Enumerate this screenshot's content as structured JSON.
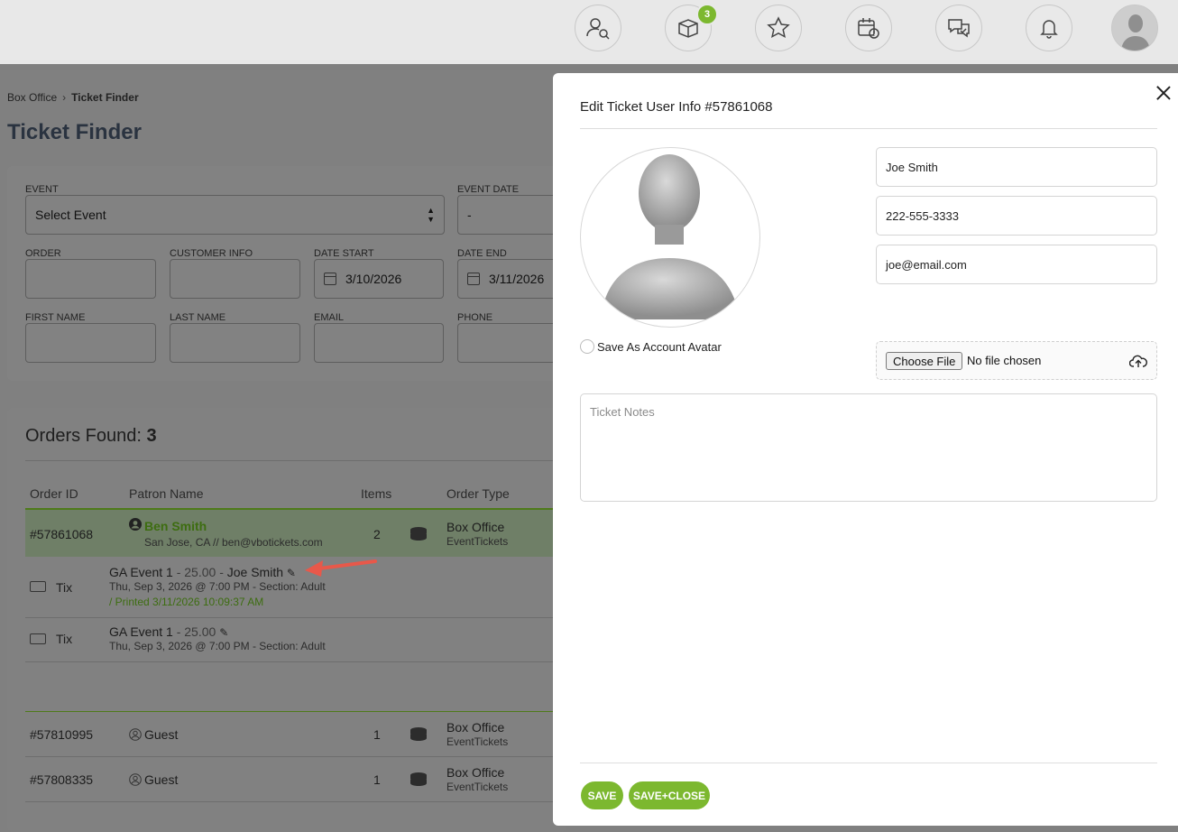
{
  "topbar": {
    "icons": [
      "user-search-icon",
      "box-icon",
      "star-icon",
      "calendar-alert-icon",
      "chat-icon",
      "bell-icon"
    ],
    "box_badge": "3"
  },
  "breadcrumb": {
    "root": "Box Office",
    "current": "Ticket Finder"
  },
  "page_title": "Ticket Finder",
  "filters": {
    "event_label": "EVENT",
    "event_value": "Select Event",
    "event_date_label": "EVENT DATE",
    "event_date_value": "-",
    "order_label": "ORDER",
    "customer_label": "CUSTOMER INFO",
    "date_start_label": "DATE START",
    "date_start_value": "3/10/2026",
    "date_end_label": "DATE END",
    "date_end_value": "3/11/2026",
    "first_name_label": "FIRST NAME",
    "last_name_label": "LAST NAME",
    "email_label": "EMAIL",
    "phone_label": "PHONE"
  },
  "orders": {
    "title": "Orders Found:",
    "count": "3",
    "headers": {
      "order_id": "Order ID",
      "patron": "Patron Name",
      "items": "Items",
      "type": "Order Type"
    },
    "first": {
      "id": "#57861068",
      "name": "Ben Smith",
      "detail": "San Jose, CA // ben@vbotickets.com",
      "items": "2",
      "type": "Box Office",
      "subtype": "EventTickets"
    },
    "tickets": [
      {
        "kind": "Tix",
        "event": "GA Event 1",
        "price": "- 25.00 -",
        "holder": "Joe Smith",
        "when": "Thu, Sep 3, 2026 @ 7:00 PM - Section: Adult",
        "printed": "/ Printed 3/11/2026 10:09:37 AM"
      },
      {
        "kind": "Tix",
        "event": "GA Event 1",
        "price": "- 25.00",
        "when": "Thu, Sep 3, 2026 @ 7:00 PM - Section: Adult"
      }
    ],
    "rows": [
      {
        "id": "#57810995",
        "name": "Guest",
        "items": "1",
        "type": "Box Office",
        "subtype": "EventTickets"
      },
      {
        "id": "#57808335",
        "name": "Guest",
        "items": "1",
        "type": "Box Office",
        "subtype": "EventTickets"
      }
    ]
  },
  "modal": {
    "title": "Edit Ticket User Info #57861068",
    "name_value": "Joe Smith",
    "phone_value": "222-555-3333",
    "email_value": "joe@email.com",
    "save_avatar_label": "Save As Account Avatar",
    "choose_file": "Choose File",
    "no_file": "No file chosen",
    "notes_placeholder": "Ticket Notes",
    "save": "SAVE",
    "save_close": "SAVE+CLOSE"
  },
  "colors": {
    "accent": "#7cb82f",
    "arrow": "#e8584a"
  }
}
